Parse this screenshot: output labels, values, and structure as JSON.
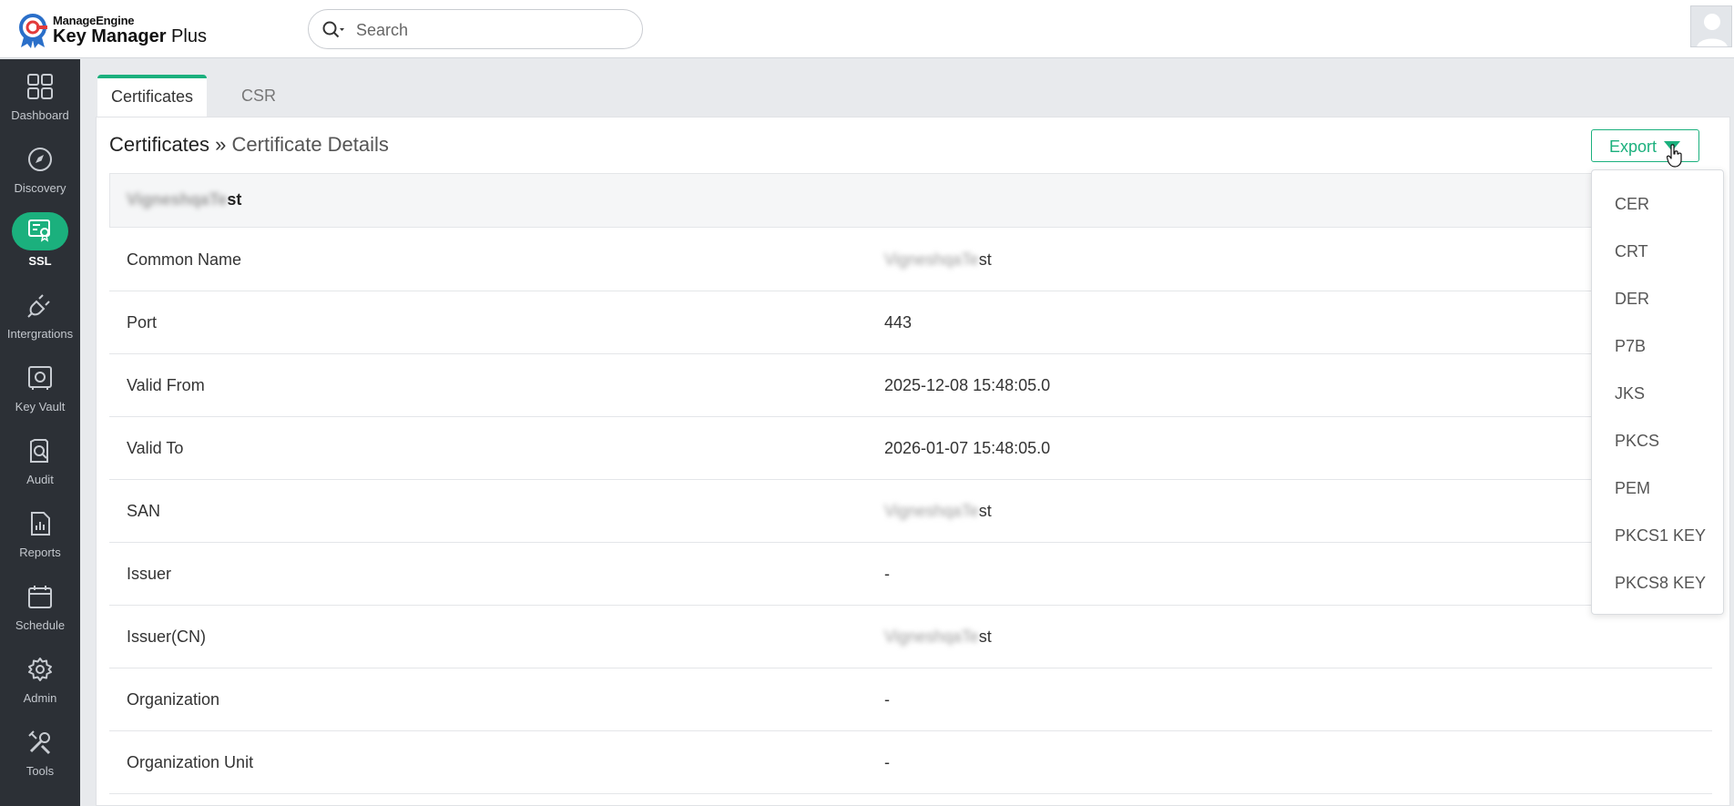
{
  "app": {
    "brand_top": "ManageEngine",
    "brand_main_bold": "Key Manager",
    "brand_main_rest": " Plus",
    "accent_color": "#1bb07d"
  },
  "search": {
    "placeholder": "Search"
  },
  "sidebar": {
    "items": [
      {
        "label": "Dashboard",
        "icon": "dashboard-grid-icon"
      },
      {
        "label": "Discovery",
        "icon": "compass-icon"
      },
      {
        "label": "SSL",
        "icon": "certificate-icon",
        "active": true
      },
      {
        "label": "Intergrations",
        "icon": "plug-icon"
      },
      {
        "label": "Key Vault",
        "icon": "vault-icon"
      },
      {
        "label": "Audit",
        "icon": "audit-search-icon"
      },
      {
        "label": "Reports",
        "icon": "reports-chart-icon"
      },
      {
        "label": "Schedule",
        "icon": "calendar-icon"
      },
      {
        "label": "Admin",
        "icon": "gear-icon"
      },
      {
        "label": "Tools",
        "icon": "tools-icon"
      }
    ]
  },
  "tabs": [
    {
      "label": "Certificates",
      "active": true
    },
    {
      "label": "CSR",
      "active": false
    }
  ],
  "page": {
    "breadcrumb_root": "Certificates",
    "breadcrumb_sep": " » ",
    "breadcrumb_current": "Certificate Details",
    "export_label": "Export",
    "cert_name_blurred": "VigneshqaTe",
    "cert_name_tail": "st"
  },
  "details": [
    {
      "key": "Common Name",
      "value_blurred": "VigneshqaTe",
      "value": "st"
    },
    {
      "key": "Port",
      "value": "443"
    },
    {
      "key": "Valid From",
      "value": "2025-12-08 15:48:05.0"
    },
    {
      "key": "Valid To",
      "value": "2026-01-07 15:48:05.0"
    },
    {
      "key": "SAN",
      "value_blurred": "VigneshqaTe",
      "value": "st"
    },
    {
      "key": "Issuer",
      "value": "-"
    },
    {
      "key": "Issuer(CN)",
      "value_blurred": "VigneshqaTe",
      "value": "st"
    },
    {
      "key": "Organization",
      "value": "-"
    },
    {
      "key": "Organization Unit",
      "value": "-"
    }
  ],
  "export_menu": [
    "CER",
    "CRT",
    "DER",
    "P7B",
    "JKS",
    "PKCS",
    "PEM",
    "PKCS1 KEY",
    "PKCS8 KEY"
  ]
}
